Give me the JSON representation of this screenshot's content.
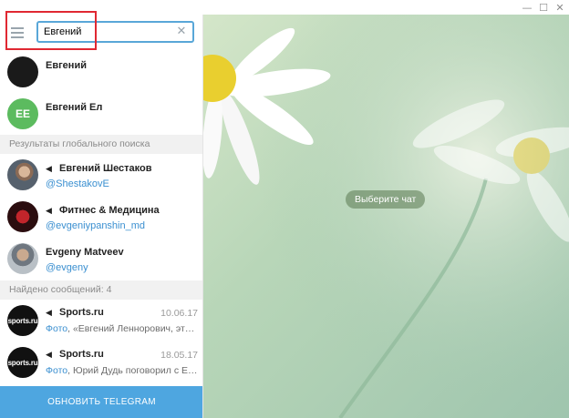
{
  "window": {
    "minimize_glyph": "—",
    "maximize_glyph": "☐",
    "close_glyph": "✕"
  },
  "search": {
    "value": "Евгений",
    "clear_glyph": "✕"
  },
  "chats": [
    {
      "name": "Евгений",
      "avatar": "photo"
    },
    {
      "name": "Евгений Ел",
      "avatar_initials": "ЕЕ",
      "avatar_color": "#5cbb5f"
    }
  ],
  "global_search": {
    "header": "Результаты глобального поиска",
    "items": [
      {
        "name": "Евгений Шестаков",
        "handle": "@ShestakovE",
        "icon": "megaphone-icon"
      },
      {
        "name": "Фитнес & Медицина",
        "handle": "@evgeniypanshin_md",
        "icon": "megaphone-icon"
      },
      {
        "name": "Evgeny Matveev",
        "handle": "@evgeny",
        "icon": ""
      }
    ]
  },
  "messages": {
    "header": "Найдено сообщений: 4",
    "items": [
      {
        "name": "Sports.ru",
        "date": "10.06.17",
        "kind": "Фото",
        "text": ", «Евгений Леннорович, это н...",
        "avatar_text": "sports.ru"
      },
      {
        "name": "Sports.ru",
        "date": "18.05.17",
        "kind": "Фото",
        "text": ", Юрий Дудь поговорил с Евг...",
        "avatar_text": "sports.ru"
      }
    ]
  },
  "update_button": "ОБНОВИТЬ TELEGRAM",
  "chat_placeholder": "Выберите чат",
  "colors": {
    "accent": "#4ea6e0",
    "link": "#3a8fd0",
    "highlight_box": "#e02832"
  }
}
